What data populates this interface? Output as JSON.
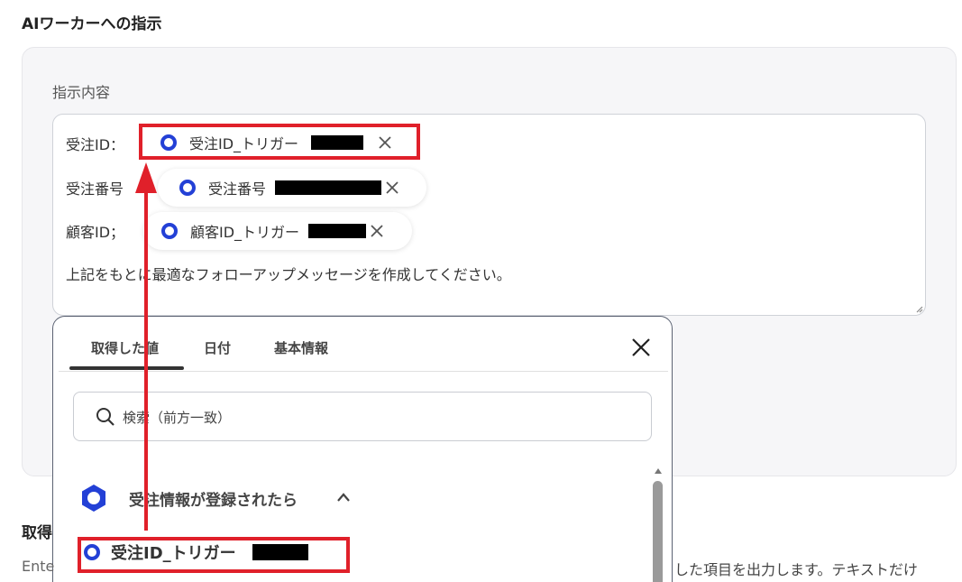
{
  "section": {
    "title": "AIワーカーへの指示"
  },
  "field": {
    "label": "指示内容"
  },
  "prompt": {
    "line1_label": "受注ID：",
    "line2_label": "受注番号",
    "line3_label": "顧客ID；",
    "body_text": "上記をもとに最適なフォローアップメッセージを作成してください。",
    "chips": [
      {
        "label": "受注ID_トリガー"
      },
      {
        "label": "受注番号"
      },
      {
        "label": "顧客ID_トリガー"
      }
    ]
  },
  "picker": {
    "tabs": [
      {
        "label": "取得した値"
      },
      {
        "label": "日付"
      },
      {
        "label": "基本情報"
      }
    ],
    "search_placeholder": "検索（前方一致）",
    "group_label": "受注情報が登録されたら",
    "item_label": "受注ID_トリガー"
  },
  "below": {
    "title": "取得",
    "left_text": "Ente",
    "right_text": "した項目を出力します。テキストだけ"
  },
  "colors": {
    "accent": "#2340d6",
    "highlight": "#e0202a"
  }
}
